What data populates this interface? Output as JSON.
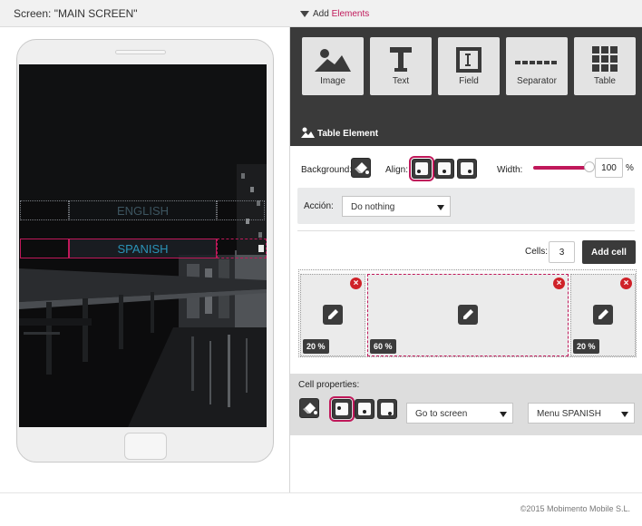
{
  "header": {
    "screen_title": "Screen: \"MAIN SCREEN\"",
    "add_label": "Add",
    "add_accent": "Elements"
  },
  "phone": {
    "menu": [
      {
        "label": "ENGLISH",
        "state": "normal"
      },
      {
        "label": "SPANISH",
        "state": "selected"
      }
    ]
  },
  "toolbox": {
    "tools": [
      {
        "label": "Image",
        "icon": "image-icon"
      },
      {
        "label": "Text",
        "icon": "text-icon"
      },
      {
        "label": "Field",
        "icon": "field-icon"
      },
      {
        "label": "Separator",
        "icon": "separator-icon"
      },
      {
        "label": "Table",
        "icon": "table-icon"
      }
    ]
  },
  "table_element": {
    "title": "Table Element",
    "background_label": "Background:",
    "align_label": "Align:",
    "align_selected": "left",
    "width_label": "Width:",
    "width_value": "100",
    "width_unit": "%",
    "width_fraction": 1.0,
    "accion_label": "Acción:",
    "accion_value": "Do nothing",
    "cells_label": "Cells:",
    "cells_value": "3",
    "add_cell_label": "Add cell",
    "cells": [
      {
        "percent": "20 %",
        "selected": false
      },
      {
        "percent": "60 %",
        "selected": true
      },
      {
        "percent": "20 %",
        "selected": false
      }
    ]
  },
  "cell_properties": {
    "title": "Cell properties:",
    "align_selected": "left",
    "action_value": "Go to screen",
    "screen_value": "Menu SPANISH"
  },
  "footer": {
    "copyright": "©2015 Mobimento Mobile S.L."
  },
  "colors": {
    "accent": "#c0185a",
    "toolbar_bg": "#3a3a3a",
    "delete_red": "#cf2128"
  }
}
